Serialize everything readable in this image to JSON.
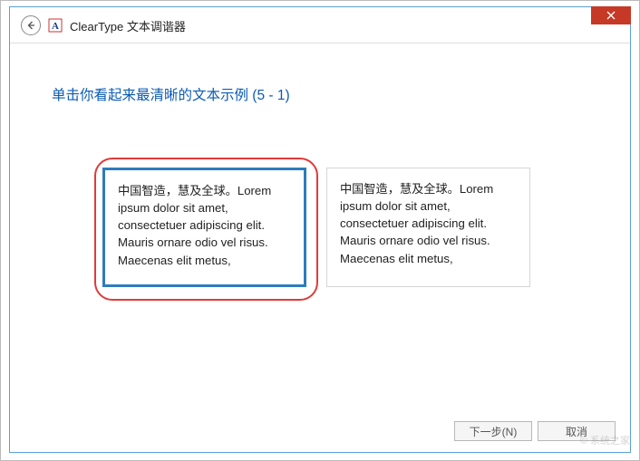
{
  "window": {
    "title": "ClearType 文本调谐器"
  },
  "instruction": "单击你看起来最清晰的文本示例 (5 - 1)",
  "samples": {
    "text": "中国智造，慧及全球。Lorem ipsum dolor sit amet, consectetuer adipiscing elit. Mauris ornare odio vel risus. Maecenas elit metus,",
    "items": [
      {
        "selected": true
      },
      {
        "selected": false
      }
    ]
  },
  "footer": {
    "next": "下一步(N)",
    "cancel": "取消"
  },
  "watermark": "© 系统之家"
}
